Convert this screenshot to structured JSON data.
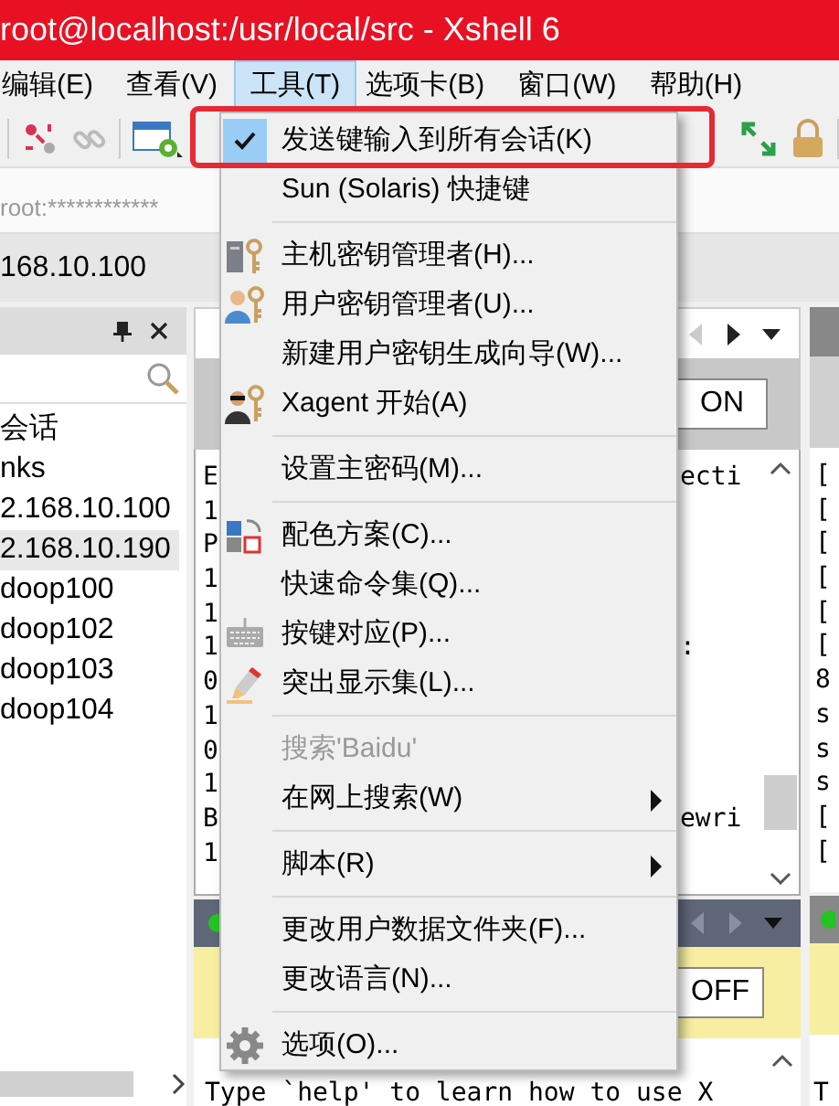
{
  "window": {
    "title": "root@localhost:/usr/local/src - Xshell 6"
  },
  "menu_bar": [
    {
      "label": "编辑(E)",
      "selected": false
    },
    {
      "label": "查看(V)",
      "selected": false
    },
    {
      "label": "工具(T)",
      "selected": true
    },
    {
      "label": "选项卡(B)",
      "selected": false
    },
    {
      "label": "窗口(W)",
      "selected": false
    },
    {
      "label": "帮助(H)",
      "selected": false
    }
  ],
  "address_bar": {
    "text": "root:************"
  },
  "session_tab": {
    "label": "168.10.100"
  },
  "sidebar": {
    "items": [
      {
        "label": "会话",
        "selected": false
      },
      {
        "label": "nks",
        "selected": false
      },
      {
        "label": "2.168.10.100",
        "selected": false
      },
      {
        "label": "2.168.10.190",
        "selected": true
      },
      {
        "label": "doop100",
        "selected": false
      },
      {
        "label": "doop102",
        "selected": false
      },
      {
        "label": "doop103",
        "selected": false
      },
      {
        "label": "doop104",
        "selected": false
      }
    ]
  },
  "terminal": {
    "toggle": "ON",
    "lines": [
      {
        "text": "E",
        "tail": "ecti"
      },
      {
        "text": "1"
      },
      {
        "text": "P"
      },
      {
        "text": "1"
      },
      {
        "text": "1"
      },
      {
        "text": "1",
        "tail": ":"
      },
      {
        "text": "0"
      },
      {
        "text": "1"
      },
      {
        "text": "0"
      },
      {
        "text": "1"
      },
      {
        "text": "B",
        "tail": "ewri"
      },
      {
        "text": "1"
      }
    ],
    "lower_toggle": "OFF",
    "lower_text": "Type `help' to learn how to use X"
  },
  "right_terminal": {
    "lines": [
      "[",
      "[",
      "[",
      "[",
      "[",
      "[",
      "8",
      "s",
      "s",
      "s",
      "[",
      "["
    ],
    "lower_text": "T"
  },
  "tools_menu": {
    "items": [
      {
        "kind": "item",
        "label": "发送键输入到所有会话(K)",
        "checked": true,
        "disabled": false,
        "submenu": false
      },
      {
        "kind": "item",
        "label": "Sun (Solaris) 快捷键",
        "checked": false,
        "disabled": false,
        "submenu": false
      },
      {
        "kind": "separator"
      },
      {
        "kind": "item",
        "label": "主机密钥管理者(H)...",
        "checked": false,
        "disabled": false,
        "submenu": false
      },
      {
        "kind": "item",
        "label": "用户密钥管理者(U)...",
        "checked": false,
        "disabled": false,
        "submenu": false
      },
      {
        "kind": "item",
        "label": "新建用户密钥生成向导(W)...",
        "checked": false,
        "disabled": false,
        "submenu": false
      },
      {
        "kind": "item",
        "label": "Xagent 开始(A)",
        "checked": false,
        "disabled": false,
        "submenu": false
      },
      {
        "kind": "separator"
      },
      {
        "kind": "item",
        "label": "设置主密码(M)...",
        "checked": false,
        "disabled": false,
        "submenu": false
      },
      {
        "kind": "separator"
      },
      {
        "kind": "item",
        "label": "配色方案(C)...",
        "checked": false,
        "disabled": false,
        "submenu": false
      },
      {
        "kind": "item",
        "label": "快速命令集(Q)...",
        "checked": false,
        "disabled": false,
        "submenu": false
      },
      {
        "kind": "item",
        "label": "按键对应(P)...",
        "checked": false,
        "disabled": false,
        "submenu": false
      },
      {
        "kind": "item",
        "label": "突出显示集(L)...",
        "checked": false,
        "disabled": false,
        "submenu": false
      },
      {
        "kind": "separator"
      },
      {
        "kind": "item",
        "label": "搜索'Baidu'",
        "checked": false,
        "disabled": true,
        "submenu": false
      },
      {
        "kind": "item",
        "label": "在网上搜索(W)",
        "checked": false,
        "disabled": false,
        "submenu": true
      },
      {
        "kind": "separator"
      },
      {
        "kind": "item",
        "label": "脚本(R)",
        "checked": false,
        "disabled": false,
        "submenu": true
      },
      {
        "kind": "separator"
      },
      {
        "kind": "item",
        "label": "更改用户数据文件夹(F)...",
        "checked": false,
        "disabled": false,
        "submenu": false
      },
      {
        "kind": "item",
        "label": "更改语言(N)...",
        "checked": false,
        "disabled": false,
        "submenu": false
      },
      {
        "kind": "separator"
      },
      {
        "kind": "item",
        "label": "选项(O)...",
        "checked": false,
        "disabled": false,
        "submenu": false
      }
    ]
  }
}
